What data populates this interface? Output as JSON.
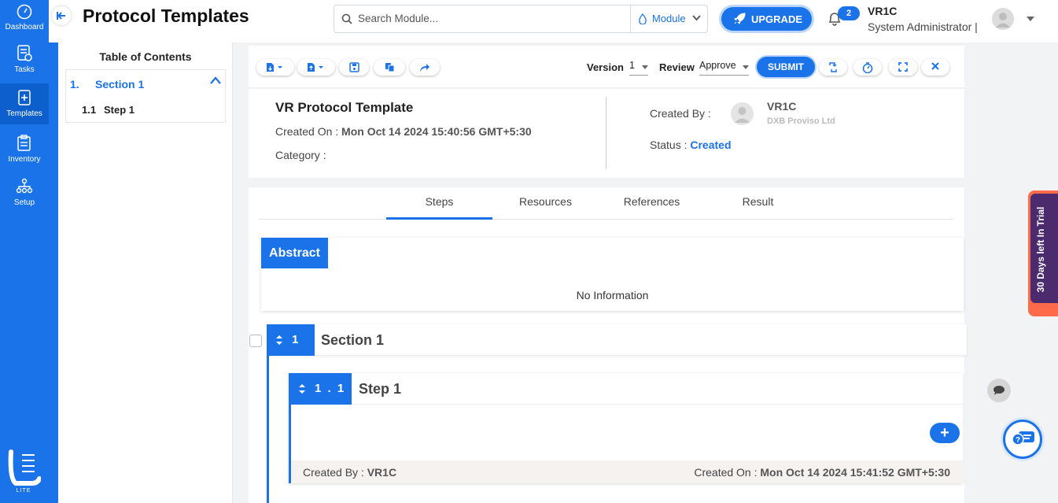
{
  "app": {
    "title": "Protocol Templates",
    "search_placeholder": "Search Module...",
    "module_label": "Module",
    "upgrade_label": "UPGRADE",
    "notification_count": "2",
    "user_name": "VR1C",
    "user_role": "System Administrator |",
    "logo_text": "LITE"
  },
  "rail": {
    "items": [
      {
        "label": "Dashboard",
        "icon": "gauge-icon"
      },
      {
        "label": "Tasks",
        "icon": "tasks-icon"
      },
      {
        "label": "Templates",
        "icon": "templates-icon"
      },
      {
        "label": "Inventory",
        "icon": "inventory-icon"
      },
      {
        "label": "Setup",
        "icon": "setup-icon"
      }
    ]
  },
  "toc": {
    "title": "Table of Contents",
    "section_num": "1.",
    "section_label": "Section 1",
    "step_num": "1.1",
    "step_label": "Step 1"
  },
  "toolbar": {
    "version_label": "Version",
    "version_value": "1",
    "review_label": "Review",
    "review_value": "Approve",
    "submit_label": "SUBMIT"
  },
  "template": {
    "title": "VR Protocol Template",
    "created_on_label": "Created On :",
    "created_on_value": "Mon Oct 14 2024 15:40:56 GMT+5:30",
    "category_label": "Category :",
    "created_by_label": "Created By :",
    "created_by_name": "VR1C",
    "created_by_org": "DXB Proviso Ltd",
    "status_label": "Status :",
    "status_value": "Created"
  },
  "tabs": [
    {
      "label": "Steps",
      "active": true
    },
    {
      "label": "Resources",
      "active": false
    },
    {
      "label": "References",
      "active": false
    },
    {
      "label": "Result",
      "active": false
    }
  ],
  "abstract": {
    "title": "Abstract",
    "body": "No Information"
  },
  "section": {
    "number": "1",
    "title": "Section 1"
  },
  "step": {
    "number": "1 . 1",
    "title": "Step 1",
    "add_label": "+",
    "created_by_label": "Created By :",
    "created_by_value": "VR1C",
    "created_on_label": "Created On :",
    "created_on_value": "Mon Oct 14 2024 15:41:52 GMT+5:30"
  },
  "trial": {
    "text": "30 Days left In Trial"
  },
  "colors": {
    "accent": "#1a73e8",
    "trial_bg": "#ff6a4a",
    "trial_inner": "#4b2a6e"
  }
}
